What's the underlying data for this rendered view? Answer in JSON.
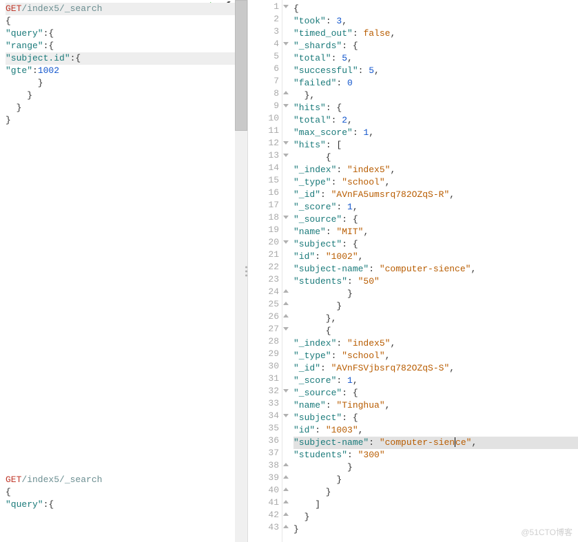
{
  "left_editor": {
    "req1": {
      "method": "GET",
      "path": "/index5/_search",
      "body_lines": [
        "{",
        "  \"query\":{",
        "    \"range\":{",
        "      \"subject.id\":{",
        "        \"gte\":1002",
        "      }",
        "    }",
        "  }",
        "}"
      ],
      "cursor_line_index": 3
    },
    "req2": {
      "method": "GET",
      "path": "/index5/_search",
      "body_lines": [
        "{",
        "  \"query\":{"
      ]
    }
  },
  "right_response": {
    "lines": [
      {
        "n": 1,
        "fold": "down",
        "text": "{"
      },
      {
        "n": 2,
        "text": "  \"took\": 3,"
      },
      {
        "n": 3,
        "text": "  \"timed_out\": false,"
      },
      {
        "n": 4,
        "fold": "down",
        "text": "  \"_shards\": {"
      },
      {
        "n": 5,
        "text": "    \"total\": 5,"
      },
      {
        "n": 6,
        "text": "    \"successful\": 5,"
      },
      {
        "n": 7,
        "text": "    \"failed\": 0"
      },
      {
        "n": 8,
        "fold": "up",
        "text": "  },"
      },
      {
        "n": 9,
        "fold": "down",
        "text": "  \"hits\": {"
      },
      {
        "n": 10,
        "text": "    \"total\": 2,"
      },
      {
        "n": 11,
        "text": "    \"max_score\": 1,"
      },
      {
        "n": 12,
        "fold": "down",
        "text": "    \"hits\": ["
      },
      {
        "n": 13,
        "fold": "down",
        "text": "      {"
      },
      {
        "n": 14,
        "text": "        \"_index\": \"index5\","
      },
      {
        "n": 15,
        "text": "        \"_type\": \"school\","
      },
      {
        "n": 16,
        "text": "        \"_id\": \"AVnFA5umsrq782OZqS-R\","
      },
      {
        "n": 17,
        "text": "        \"_score\": 1,"
      },
      {
        "n": 18,
        "fold": "down",
        "text": "        \"_source\": {"
      },
      {
        "n": 19,
        "text": "          \"name\": \"MIT\","
      },
      {
        "n": 20,
        "fold": "down",
        "text": "          \"subject\": {"
      },
      {
        "n": 21,
        "text": "            \"id\": \"1002\","
      },
      {
        "n": 22,
        "text": "            \"subject-name\": \"computer-sience\","
      },
      {
        "n": 23,
        "text": "            \"students\": \"50\""
      },
      {
        "n": 24,
        "fold": "up",
        "text": "          }"
      },
      {
        "n": 25,
        "fold": "up",
        "text": "        }"
      },
      {
        "n": 26,
        "fold": "up",
        "text": "      },"
      },
      {
        "n": 27,
        "fold": "down",
        "text": "      {"
      },
      {
        "n": 28,
        "text": "        \"_index\": \"index5\","
      },
      {
        "n": 29,
        "text": "        \"_type\": \"school\","
      },
      {
        "n": 30,
        "text": "        \"_id\": \"AVnFSVjbsrq782OZqS-S\","
      },
      {
        "n": 31,
        "text": "        \"_score\": 1,"
      },
      {
        "n": 32,
        "fold": "down",
        "text": "        \"_source\": {"
      },
      {
        "n": 33,
        "text": "          \"name\": \"Tinghua\","
      },
      {
        "n": 34,
        "fold": "down",
        "text": "          \"subject\": {"
      },
      {
        "n": 35,
        "text": "            \"id\": \"1003\","
      },
      {
        "n": 36,
        "hl": true,
        "text": "            \"subject-name\": \"computer-sience\","
      },
      {
        "n": 37,
        "text": "            \"students\": \"300\""
      },
      {
        "n": 38,
        "fold": "up",
        "text": "          }"
      },
      {
        "n": 39,
        "fold": "up",
        "text": "        }"
      },
      {
        "n": 40,
        "fold": "up",
        "text": "      }"
      },
      {
        "n": 41,
        "fold": "up",
        "text": "    ]"
      },
      {
        "n": 42,
        "fold": "up",
        "text": "  }"
      },
      {
        "n": 43,
        "fold": "up",
        "text": "}"
      }
    ],
    "cursor_at": {
      "line": 36,
      "after_text": "computer-sien"
    }
  },
  "watermark": "@51CTO博客"
}
